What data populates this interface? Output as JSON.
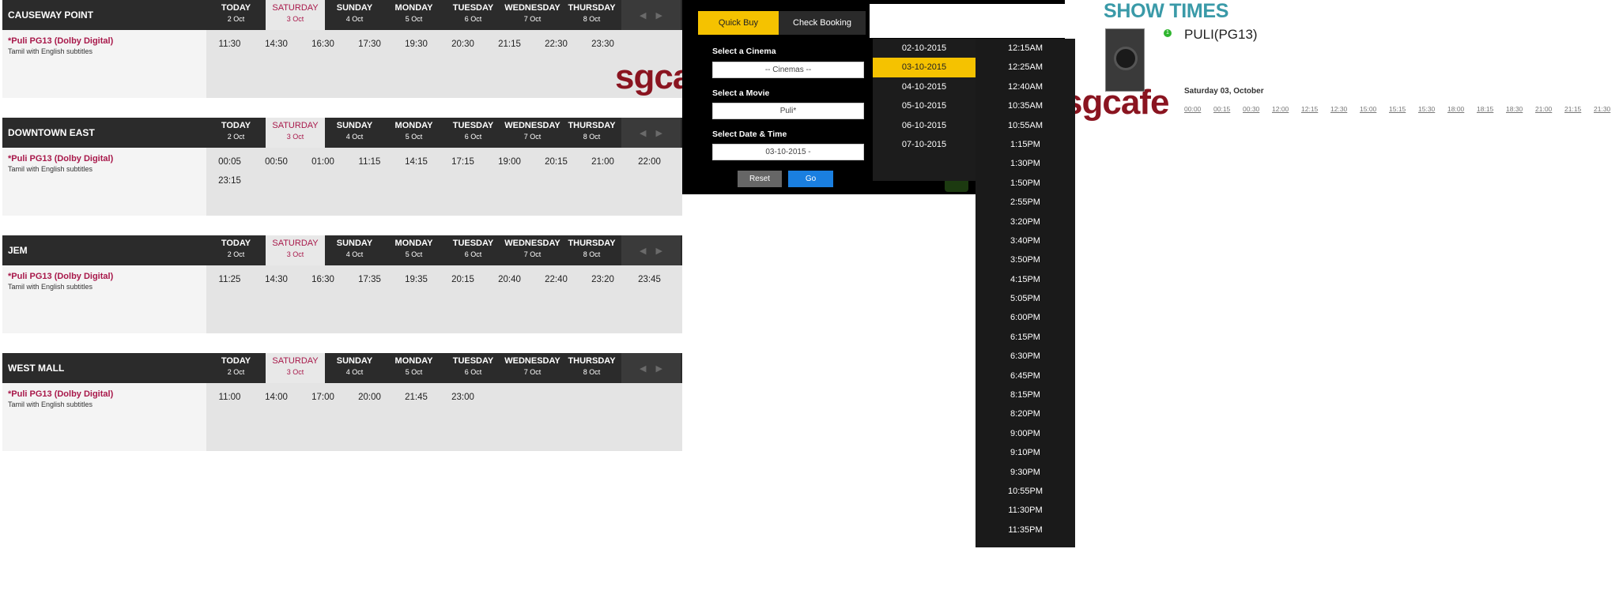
{
  "days": [
    {
      "name": "TODAY",
      "date": "2 Oct"
    },
    {
      "name": "SATURDAY",
      "date": "3 Oct"
    },
    {
      "name": "SUNDAY",
      "date": "4 Oct"
    },
    {
      "name": "MONDAY",
      "date": "5 Oct"
    },
    {
      "name": "TUESDAY",
      "date": "6 Oct"
    },
    {
      "name": "WEDNESDAY",
      "date": "7 Oct"
    },
    {
      "name": "THURSDAY",
      "date": "8 Oct"
    }
  ],
  "nav": {
    "prev": "◀",
    "next": "▶"
  },
  "cinemas": [
    {
      "name": "CAUSEWAY POINT",
      "movie": "*Puli PG13 (Dolby Digital)",
      "subtitle": "Tamil with English subtitles",
      "times": [
        "11:30",
        "14:30",
        "16:30",
        "17:30",
        "19:30",
        "20:30",
        "21:15",
        "22:30",
        "23:30"
      ]
    },
    {
      "name": "DOWNTOWN EAST",
      "movie": "*Puli PG13 (Dolby Digital)",
      "subtitle": "Tamil with English subtitles",
      "times": [
        "00:05",
        "00:50",
        "01:00",
        "11:15",
        "14:15",
        "17:15",
        "19:00",
        "20:15",
        "21:00",
        "22:00",
        "23:15"
      ]
    },
    {
      "name": "JEM",
      "movie": "*Puli PG13 (Dolby Digital)",
      "subtitle": "Tamil with English subtitles",
      "times": [
        "11:25",
        "14:30",
        "16:30",
        "17:35",
        "19:35",
        "20:15",
        "20:40",
        "22:40",
        "23:20",
        "23:45"
      ]
    },
    {
      "name": "WEST MALL",
      "movie": "*Puli PG13 (Dolby Digital)",
      "subtitle": "Tamil with English subtitles",
      "times": [
        "11:00",
        "14:00",
        "17:00",
        "20:00",
        "21:45",
        "23:00"
      ]
    }
  ],
  "watermark": "sgcafe",
  "quick_buy": {
    "tab_quick": "Quick Buy",
    "tab_check": "Check Booking",
    "cinema_label": "Select a Cinema",
    "cinema_value": "-- Cinemas --",
    "movie_label": "Select a Movie",
    "movie_value": "Puli*",
    "date_label": "Select Date & Time",
    "date_value": "03-10-2015 -",
    "reset": "Reset",
    "go": "Go",
    "dates": [
      "02-10-2015",
      "03-10-2015",
      "04-10-2015",
      "05-10-2015",
      "06-10-2015",
      "07-10-2015"
    ],
    "selected_date": "03-10-2015",
    "timeslots": [
      "12:15AM",
      "12:25AM",
      "12:40AM",
      "10:35AM",
      "10:55AM",
      "1:15PM",
      "1:30PM",
      "1:50PM",
      "2:55PM",
      "3:20PM",
      "3:40PM",
      "3:50PM",
      "4:15PM",
      "5:05PM",
      "6:00PM",
      "6:15PM",
      "6:30PM",
      "6:45PM",
      "8:15PM",
      "8:20PM",
      "9:00PM",
      "9:10PM",
      "9:30PM",
      "10:55PM",
      "11:30PM",
      "11:35PM"
    ]
  },
  "show_times": {
    "title": "SHOW TIMES",
    "badge": "1",
    "movie": "PULI(PG13)",
    "date": "Saturday 03, October",
    "times": [
      "00:00",
      "00:15",
      "00:30",
      "12:00",
      "12:15",
      "12:30",
      "15:00",
      "15:15",
      "15:30",
      "18:00",
      "18:15",
      "18:30",
      "21:00",
      "21:15",
      "21:30"
    ]
  }
}
